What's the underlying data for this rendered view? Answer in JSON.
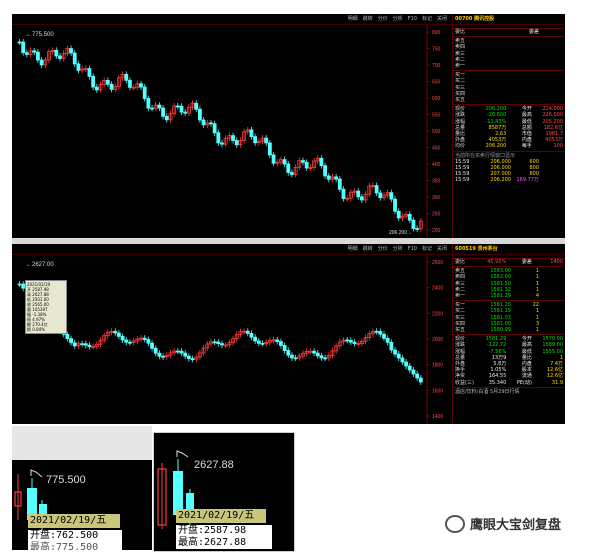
{
  "toolbar_items": [
    "明细",
    "跳转",
    "分价",
    "分析",
    "F10",
    "标记",
    "关闭"
  ],
  "top": {
    "stock_name": "00700 腾讯控股",
    "high_label": "775.500",
    "low_label": "206.200",
    "yticks": [
      "800",
      "750",
      "700",
      "650",
      "600",
      "550",
      "500",
      "450",
      "400",
      "350",
      "300",
      "250",
      "200"
    ],
    "rows_top": [
      {
        "l": "委比",
        "v": "",
        "c": "委差"
      },
      {
        "l": "卖五",
        "v": "",
        "c": ""
      },
      {
        "l": "卖四",
        "v": "",
        "c": ""
      },
      {
        "l": "卖三",
        "v": "",
        "c": ""
      },
      {
        "l": "卖二",
        "v": "",
        "c": ""
      },
      {
        "l": "卖一",
        "v": "",
        "c": ""
      },
      {
        "l": "买一",
        "v": "",
        "c": ""
      },
      {
        "l": "买二",
        "v": "",
        "c": ""
      },
      {
        "l": "买三",
        "v": "",
        "c": ""
      },
      {
        "l": "买四",
        "v": "",
        "c": ""
      },
      {
        "l": "买五",
        "v": "",
        "c": ""
      }
    ],
    "notice": [
      "港股行情",
      "延时15分钟"
    ],
    "stats": [
      {
        "l": "现价",
        "v": "206.200",
        "l2": "今开",
        "v2": "224.000"
      },
      {
        "l": "涨跌",
        "v": "-26.600",
        "l2": "最高",
        "v2": "226.000"
      },
      {
        "l": "涨幅",
        "v": "-11.43%",
        "l2": "最低",
        "v2": "205.200"
      },
      {
        "l": "总量",
        "v": "8587万",
        "l2": "总额",
        "v2": "182.6亿"
      },
      {
        "l": "量比",
        "v": "2.63",
        "l2": "市值",
        "v2": "1981.7"
      },
      {
        "l": "外盘",
        "v": "4053万",
        "l2": "内盘",
        "v2": "4053万"
      },
      {
        "l": "均价",
        "v": "206.200",
        "l2": "每手",
        "v2": "100"
      }
    ],
    "caption": "当前所在买卖行情窗口显示",
    "ticks": [
      {
        "t": "15:59",
        "p": "206.000",
        "v": "600"
      },
      {
        "t": "15:59",
        "p": "206.000",
        "v": "800"
      },
      {
        "t": "15:59",
        "p": "207.000",
        "v": "800"
      },
      {
        "t": "15:59",
        "p": "206.200",
        "v": "169.77万"
      }
    ]
  },
  "mid": {
    "stock_name": "600519 贵州茅台",
    "high_label": "2627.00",
    "yticks": [
      "2600",
      "2400",
      "2200",
      "2000",
      "1800",
      "1600",
      "1400"
    ],
    "weibi": {
      "l": "委比",
      "v": "45.95%",
      "l2": "委差",
      "v2": "1400"
    },
    "asks": [
      {
        "l": "卖五",
        "p": "1583.00",
        "q": "1"
      },
      {
        "l": "卖四",
        "p": "1582.00",
        "q": "1"
      },
      {
        "l": "卖三",
        "p": "1581.50",
        "q": "1"
      },
      {
        "l": "卖二",
        "p": "1581.32",
        "q": "1"
      },
      {
        "l": "卖一",
        "p": "1581.29",
        "q": "4"
      }
    ],
    "bids": [
      {
        "l": "买一",
        "p": "1581.20",
        "q": "22"
      },
      {
        "l": "买二",
        "p": "1581.19",
        "q": "1"
      },
      {
        "l": "买三",
        "p": "1581.03",
        "q": "1"
      },
      {
        "l": "买四",
        "p": "1581.00",
        "q": "3"
      },
      {
        "l": "买五",
        "p": "1580.99",
        "q": "1"
      }
    ],
    "stats": [
      {
        "l": "现价",
        "v": "1581.29",
        "l2": "今开",
        "v2": "1570.00"
      },
      {
        "l": "涨跌",
        "v": "-122.72",
        "l2": "最高",
        "v2": "1589.00"
      },
      {
        "l": "涨幅",
        "v": "-7.56%",
        "l2": "最低",
        "v2": "1555.00"
      },
      {
        "l": "总量",
        "v": "13万9",
        "l2": "量比",
        "v2": "1"
      },
      {
        "l": "外盘",
        "v": "5.8万",
        "l2": "内盘",
        "v2": "7.4万"
      },
      {
        "l": "换手",
        "v": "1.05%",
        "l2": "股本",
        "v2": "12.6亿"
      },
      {
        "l": "净资",
        "v": "164.55",
        "l2": "流通",
        "v2": "12.6亿"
      },
      {
        "l": "收益(三)",
        "v": "35.340",
        "l2": "PE(动)",
        "v2": "31.9"
      }
    ],
    "footer": "酒店/饮料/白酒 5月29日行情",
    "pricebox": [
      "2021/02/19",
      "开 2587.98",
      "高 2627.88",
      "低 2501.00",
      "收 2565.00",
      "量 105397",
      "幅 -1.38%",
      "振 4.97%",
      "额 270.4亿",
      "换 0.84%"
    ]
  },
  "zoom_left": {
    "peak": "775.500",
    "date": "2021/02/19/五",
    "open": "开盘:762.500",
    "close": "最高:775.500"
  },
  "zoom_right": {
    "peak": "2627.88",
    "date": "2021/02/19/五",
    "open": "开盘:2587.98",
    "high": "最高:2627.88"
  },
  "watermark": "鹰眼大宝剑复盘",
  "colors": {
    "up": "#ff3b3b",
    "down": "#54ffff",
    "ma": "#dddddd",
    "accent": "#ffcc00"
  }
}
